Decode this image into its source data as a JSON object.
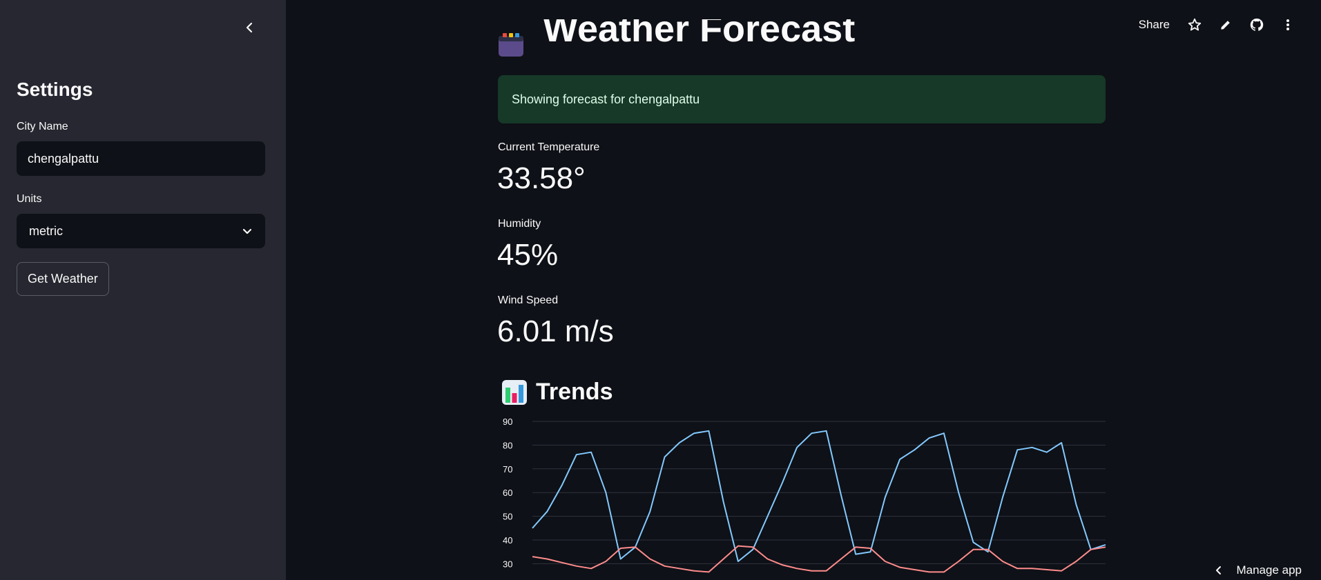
{
  "sidebar": {
    "title": "Settings",
    "city_label": "City Name",
    "city_value": "chengalpattu",
    "units_label": "Units",
    "units_value": "metric",
    "button_label": "Get Weather"
  },
  "toolbar": {
    "share_label": "Share"
  },
  "main": {
    "title": "Weather Forecast",
    "alert": "Showing forecast for chengalpattu",
    "metrics": [
      {
        "label": "Current Temperature",
        "value": "33.58°"
      },
      {
        "label": "Humidity",
        "value": "45%"
      },
      {
        "label": "Wind Speed",
        "value": "6.01 m/s"
      }
    ],
    "trends_title": "Trends"
  },
  "footer": {
    "manage_label": "Manage app"
  },
  "colors": {
    "background": "#0e1117",
    "sidebar": "#262730",
    "success_bg": "#173928",
    "humidity_line": "#83c9ff",
    "temperature_line": "#ff8c8c"
  },
  "chart_data": {
    "type": "line",
    "y_ticks": [
      90,
      80,
      70,
      60,
      50,
      40,
      30
    ],
    "ylim": [
      26,
      90
    ],
    "x": [
      0,
      1,
      2,
      3,
      4,
      5,
      6,
      7,
      8,
      9,
      10,
      11,
      12,
      13,
      14,
      15,
      16,
      17,
      18,
      19,
      20,
      21,
      22,
      23,
      24,
      25,
      26,
      27,
      28,
      29,
      30,
      31,
      32,
      33,
      34,
      35,
      36,
      37,
      38,
      39
    ],
    "series": [
      {
        "color": "#83c9ff",
        "values": [
          45,
          52,
          63,
          76,
          77,
          60,
          32,
          37,
          52,
          75,
          81,
          85,
          86,
          56,
          31,
          36,
          50,
          64,
          79,
          85,
          86,
          59,
          34,
          35,
          58,
          74,
          78,
          83,
          85,
          60,
          39,
          35,
          58,
          78,
          79,
          77,
          81,
          55,
          36,
          38
        ]
      },
      {
        "color": "#ff8c8c",
        "values": [
          33,
          32,
          30.5,
          29,
          28,
          31,
          36.5,
          37,
          32,
          29,
          28,
          27,
          26.5,
          32,
          37.5,
          37,
          32,
          29.5,
          28,
          27,
          27,
          32,
          37,
          36.5,
          31,
          28.5,
          27.5,
          26.5,
          26.5,
          31,
          36,
          36,
          31,
          28,
          28,
          27.5,
          27,
          31,
          36,
          37
        ]
      }
    ],
    "grid": true
  }
}
